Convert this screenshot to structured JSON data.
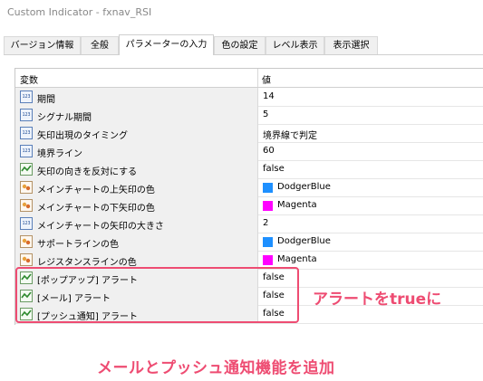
{
  "window": {
    "title": "Custom Indicator - fxnav_RSI"
  },
  "tabs": [
    {
      "label": "バージョン情報"
    },
    {
      "label": "全般"
    },
    {
      "label": "パラメーターの入力"
    },
    {
      "label": "色の設定"
    },
    {
      "label": "レベル表示"
    },
    {
      "label": "表示選択"
    }
  ],
  "table": {
    "headers": {
      "variable": "変数",
      "value": "値"
    },
    "rows": [
      {
        "icon": "number-icon",
        "name": "期間",
        "value": "14"
      },
      {
        "icon": "number-icon",
        "name": "シグナル期間",
        "value": "5"
      },
      {
        "icon": "number-icon",
        "name": "矢印出現のタイミング",
        "value": "境界線で判定"
      },
      {
        "icon": "number-icon",
        "name": "境界ライン",
        "value": "60"
      },
      {
        "icon": "boolean-icon",
        "name": "矢印の向きを反対にする",
        "value": "false"
      },
      {
        "icon": "color-icon",
        "name": "メインチャートの上矢印の色",
        "value": "DodgerBlue",
        "color": "#1e90ff"
      },
      {
        "icon": "color-icon",
        "name": "メインチャートの下矢印の色",
        "value": "Magenta",
        "color": "#ff00ff"
      },
      {
        "icon": "number-icon",
        "name": "メインチャートの矢印の大きさ",
        "value": "2"
      },
      {
        "icon": "color-icon",
        "name": "サポートラインの色",
        "value": "DodgerBlue",
        "color": "#1e90ff"
      },
      {
        "icon": "color-icon",
        "name": "レジスタンスラインの色",
        "value": "Magenta",
        "color": "#ff00ff"
      },
      {
        "icon": "boolean-icon",
        "name": "[ポップアップ] アラート",
        "value": "false"
      },
      {
        "icon": "boolean-icon",
        "name": "[メール] アラート",
        "value": "false"
      },
      {
        "icon": "boolean-icon",
        "name": "[プッシュ通知] アラート",
        "value": "false"
      }
    ]
  },
  "annotations": {
    "alert_note": "アラートをtrueに",
    "feature_note": "メールとプッシュ通知機能を追加"
  },
  "colors": {
    "accent": "#ee4c72"
  }
}
